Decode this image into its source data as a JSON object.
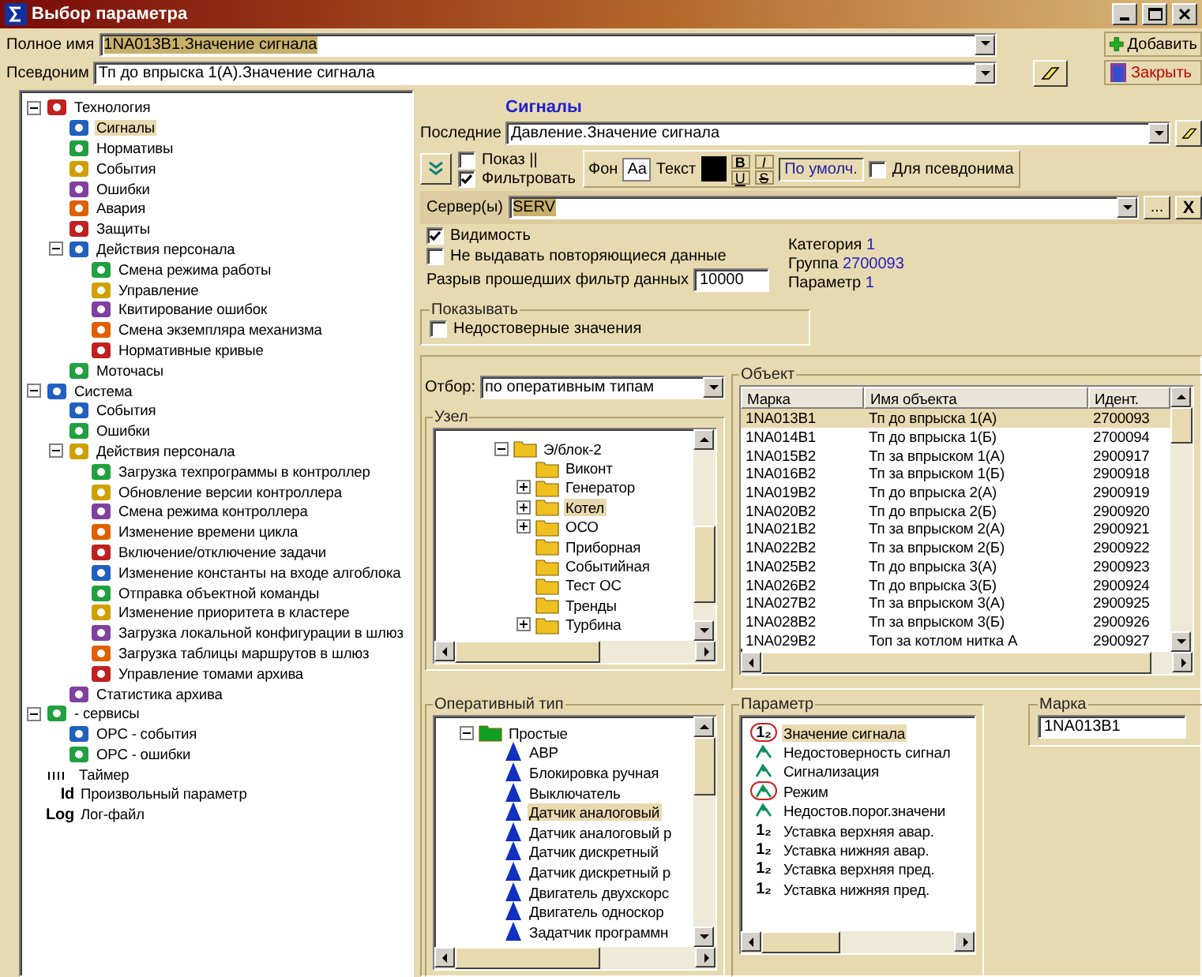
{
  "window": {
    "title": "Выбор параметра"
  },
  "full_name": {
    "label": "Полное имя",
    "value": "1NA013B1.Значение сигнала"
  },
  "alias": {
    "label": "Псевдоним",
    "value": "Тп до впрыска 1(А).Значение сигнала"
  },
  "actions": [
    {
      "kind": "add",
      "label": "Добавить"
    },
    {
      "kind": "close",
      "label": "Закрыть"
    }
  ],
  "tree": [
    {
      "label": "Технология",
      "selected": false,
      "expanded": true,
      "children": [
        {
          "label": "Сигналы",
          "selected": true
        },
        {
          "label": "Нормативы",
          "selected": false
        },
        {
          "label": "События",
          "selected": false
        },
        {
          "label": "Ошибки",
          "selected": false
        },
        {
          "label": "Авария",
          "selected": false
        },
        {
          "label": "Защиты",
          "selected": false
        },
        {
          "label": "Действия персонала",
          "selected": false,
          "expanded": true,
          "children": [
            {
              "label": "Смена режима работы",
              "selected": false
            },
            {
              "label": "Управление",
              "selected": false
            },
            {
              "label": "Квитирование ошибок",
              "selected": false
            },
            {
              "label": "Смена экземпляра механизма",
              "selected": false
            },
            {
              "label": "Нормативные кривые",
              "selected": false
            }
          ]
        },
        {
          "label": "Моточасы",
          "selected": false
        }
      ]
    },
    {
      "label": "Система",
      "selected": false,
      "expanded": true,
      "children": [
        {
          "label": "События",
          "selected": false
        },
        {
          "label": "Ошибки",
          "selected": false
        },
        {
          "label": "Действия персонала",
          "selected": false,
          "expanded": true,
          "children": [
            {
              "label": "Загрузка техпрограммы в контроллер",
              "selected": false
            },
            {
              "label": "Обновление версии контроллера",
              "selected": false
            },
            {
              "label": "Смена режима контроллера",
              "selected": false
            },
            {
              "label": "Изменение времени цикла",
              "selected": false
            },
            {
              "label": "Включение/отключение задачи",
              "selected": false
            },
            {
              "label": "Изменение константы на входе алгоблока",
              "selected": false
            },
            {
              "label": "Отправка объектной команды",
              "selected": false
            },
            {
              "label": "Изменение приоритета в кластере",
              "selected": false
            },
            {
              "label": "Загрузка локальной конфигурации в шлюз",
              "selected": false
            },
            {
              "label": "Загрузка таблицы маршрутов в шлюз",
              "selected": false
            },
            {
              "label": "Управление томами архива",
              "selected": false
            }
          ]
        },
        {
          "label": "Статистика архива",
          "selected": false
        }
      ]
    },
    {
      "label": "- сервисы",
      "selected": false,
      "expanded": true,
      "children": [
        {
          "label": "OPC - события",
          "selected": false
        },
        {
          "label": "OPC - ошибки",
          "selected": false
        }
      ]
    },
    {
      "label": "Таймер",
      "selected": false
    },
    {
      "label": "Произвольный параметр",
      "glyph": "Id",
      "selected": false
    },
    {
      "label": "Лог-файл",
      "glyph": "Log",
      "selected": false
    }
  ],
  "section_title": "Сигналы",
  "recent": {
    "label": "Последние",
    "value": "Давление.Значение сигнала"
  },
  "view_options": [
    {
      "label": "Показ ||",
      "checked": false
    },
    {
      "label": "Фильтровать",
      "checked": true
    }
  ],
  "format": {
    "background_label": "Фон",
    "sample": "Aa",
    "text_label": "Текст",
    "bold": "B",
    "italic": "I",
    "underline": "U",
    "strike": "S",
    "default_button": "По умолч.",
    "for_alias": {
      "label": "Для псевдонима",
      "checked": false
    }
  },
  "servers": {
    "label": "Сервер(ы)",
    "value": "SERV",
    "browse": "...",
    "clear": "X"
  },
  "options": [
    {
      "label": "Видимость",
      "checked": true
    },
    {
      "label": "Не выдавать повторяющиеся данные",
      "checked": false
    }
  ],
  "gap": {
    "label": "Разрыв прошедших фильтр данных",
    "value": "10000"
  },
  "info": [
    {
      "label": "Категория",
      "value": "1"
    },
    {
      "label": "Группа",
      "value": "2700093"
    },
    {
      "label": "Параметр",
      "value": "1"
    }
  ],
  "show_group": {
    "title": "Показывать",
    "options": [
      {
        "label": "Недостоверные значения",
        "checked": false
      }
    ]
  },
  "filter": {
    "label": "Отбор:",
    "value": "по оперативным типам"
  },
  "node_group": {
    "title": "Узел",
    "tree": [
      {
        "label": "Э/блок-2",
        "selected": false,
        "expanded": true,
        "children": [
          {
            "label": "Виконт",
            "selected": false
          },
          {
            "label": "Генератор",
            "selected": false,
            "expanded": false
          },
          {
            "label": "Котел",
            "selected": true,
            "expanded": false
          },
          {
            "label": "ОСО",
            "selected": false,
            "expanded": false
          },
          {
            "label": "Приборная",
            "selected": false
          },
          {
            "label": "Событийная",
            "selected": false
          },
          {
            "label": "Тест ОС",
            "selected": false
          },
          {
            "label": "Тренды",
            "selected": false
          },
          {
            "label": "Турбина",
            "selected": false,
            "expanded": false
          }
        ]
      }
    ]
  },
  "object_group": {
    "title": "Объект",
    "columns": [
      "Марка",
      "Имя объекта",
      "Идент."
    ],
    "rows": [
      {
        "cells": [
          "1NA013B1",
          "Тп до впрыска 1(А)",
          "2700093"
        ],
        "selected": true
      },
      {
        "cells": [
          "1NA014B1",
          "Тп до впрыска 1(Б)",
          "2700094"
        ],
        "selected": false
      },
      {
        "cells": [
          "1NA015B2",
          "Тп за впрыском 1(А)",
          "2900917"
        ],
        "selected": false
      },
      {
        "cells": [
          "1NA016B2",
          "Тп за впрыском 1(Б)",
          "2900918"
        ],
        "selected": false
      },
      {
        "cells": [
          "1NA019B2",
          "Тп до впрыска 2(А)",
          "2900919"
        ],
        "selected": false
      },
      {
        "cells": [
          "1NA020B2",
          "Тп до впрыска 2(Б)",
          "2900920"
        ],
        "selected": false
      },
      {
        "cells": [
          "1NA021B2",
          "Тп за впрыском 2(А)",
          "2900921"
        ],
        "selected": false
      },
      {
        "cells": [
          "1NA022B2",
          "Тп за впрыском 2(Б)",
          "2900922"
        ],
        "selected": false
      },
      {
        "cells": [
          "1NA025B2",
          "Тп до впрыска 3(А)",
          "2900923"
        ],
        "selected": false
      },
      {
        "cells": [
          "1NA026B2",
          "Тп до впрыска 3(Б)",
          "2900924"
        ],
        "selected": false
      },
      {
        "cells": [
          "1NA027B2",
          "Тп за впрыском 3(А)",
          "2900925"
        ],
        "selected": false
      },
      {
        "cells": [
          "1NA028B2",
          "Тп за впрыском 3(Б)",
          "2900926"
        ],
        "selected": false
      },
      {
        "cells": [
          "1NA029B2",
          "Топ за котлом нитка А",
          "2900927"
        ],
        "selected": false
      }
    ]
  },
  "optype_group": {
    "title": "Оперативный тип",
    "tree": [
      {
        "label": "Простые",
        "selected": false,
        "expanded": true,
        "children": [
          {
            "label": "АВР",
            "selected": false
          },
          {
            "label": "Блокировка ручная",
            "selected": false
          },
          {
            "label": "Выключатель",
            "selected": false
          },
          {
            "label": "Датчик аналоговый",
            "selected": true
          },
          {
            "label": "Датчик аналоговый р",
            "selected": false
          },
          {
            "label": "Датчик дискретный",
            "selected": false
          },
          {
            "label": "Датчик дискретный р",
            "selected": false
          },
          {
            "label": "Двигатель двухскорс",
            "selected": false
          },
          {
            "label": "Двигатель односкор",
            "selected": false
          },
          {
            "label": "Задатчик программн",
            "selected": false
          }
        ]
      }
    ]
  },
  "param_group": {
    "title": "Параметр",
    "items": [
      {
        "kind": "number",
        "glyph": "1₂",
        "label": "Значение сигнала",
        "circled": true,
        "selected": true
      },
      {
        "kind": "signal",
        "label": "Недостоверность сигнал",
        "circled": false,
        "selected": false
      },
      {
        "kind": "signal",
        "label": "Сигнализация",
        "circled": false,
        "selected": false
      },
      {
        "kind": "signal",
        "label": "Режим",
        "circled": true,
        "selected": false
      },
      {
        "kind": "signal",
        "label": "Недостов.порог.значени",
        "circled": false,
        "selected": false
      },
      {
        "kind": "number",
        "glyph": "1₂",
        "label": "Уставка верхняя авар.",
        "circled": false,
        "selected": false
      },
      {
        "kind": "number",
        "glyph": "1₂",
        "label": "Уставка нижняя авар.",
        "circled": false,
        "selected": false
      },
      {
        "kind": "number",
        "glyph": "1₂",
        "label": "Уставка верхняя пред.",
        "circled": false,
        "selected": false
      },
      {
        "kind": "number",
        "glyph": "1₂",
        "label": "Уставка нижняя пред.",
        "circled": false,
        "selected": false
      }
    ]
  },
  "mark_group": {
    "title": "Марка",
    "value": "1NA013B1"
  }
}
